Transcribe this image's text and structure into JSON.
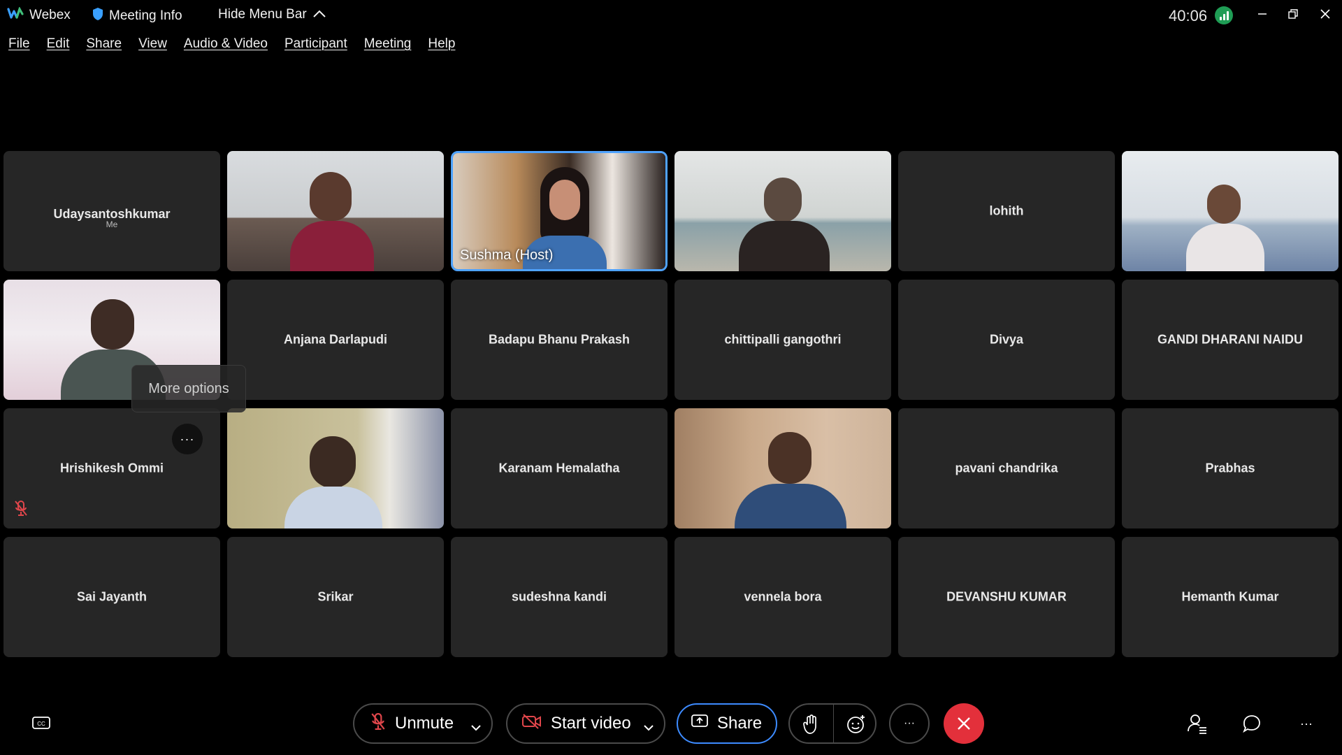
{
  "titlebar": {
    "app_name": "Webex",
    "meeting_info": "Meeting Info",
    "hide_menu": "Hide Menu Bar",
    "timer": "40:06"
  },
  "menu": [
    "File",
    "Edit",
    "Share",
    "View",
    "Audio & Video",
    "Participant",
    "Meeting",
    "Help"
  ],
  "participants": [
    {
      "name": "Udaysantoshkumar",
      "sub": "Me",
      "video": false
    },
    {
      "name": "",
      "video": true
    },
    {
      "name": "Sushma (Host)",
      "video": true,
      "host": true
    },
    {
      "name": "",
      "video": true
    },
    {
      "name": "lohith",
      "video": false
    },
    {
      "name": "",
      "video": true
    },
    {
      "name": "",
      "video": true
    },
    {
      "name": "Anjana Darlapudi",
      "video": false
    },
    {
      "name": "Badapu Bhanu Prakash",
      "video": false
    },
    {
      "name": "chittipalli gangothri",
      "video": false
    },
    {
      "name": "Divya",
      "video": false
    },
    {
      "name": "GANDI DHARANI NAIDU",
      "video": false
    },
    {
      "name": "Hrishikesh Ommi",
      "video": false,
      "muted": true,
      "more": true
    },
    {
      "name": "",
      "video": true
    },
    {
      "name": "Karanam Hemalatha",
      "video": false
    },
    {
      "name": "",
      "video": true
    },
    {
      "name": "pavani chandrika",
      "video": false
    },
    {
      "name": "Prabhas",
      "video": false
    },
    {
      "name": "Sai Jayanth",
      "video": false
    },
    {
      "name": "Srikar",
      "video": false
    },
    {
      "name": "sudeshna kandi",
      "video": false
    },
    {
      "name": "vennela bora",
      "video": false
    },
    {
      "name": "DEVANSHU KUMAR",
      "video": false
    },
    {
      "name": "Hemanth Kumar",
      "video": false
    }
  ],
  "tooltip": "More options",
  "more_dots": "···",
  "controls": {
    "unmute": "Unmute",
    "start_video": "Start video",
    "share": "Share",
    "more": "···",
    "right_more": "···"
  },
  "colors": {
    "end_call": "#e3303b",
    "host_border": "#4fa3ff",
    "share_border": "#3d8bff",
    "signal": "#1f9d55"
  }
}
